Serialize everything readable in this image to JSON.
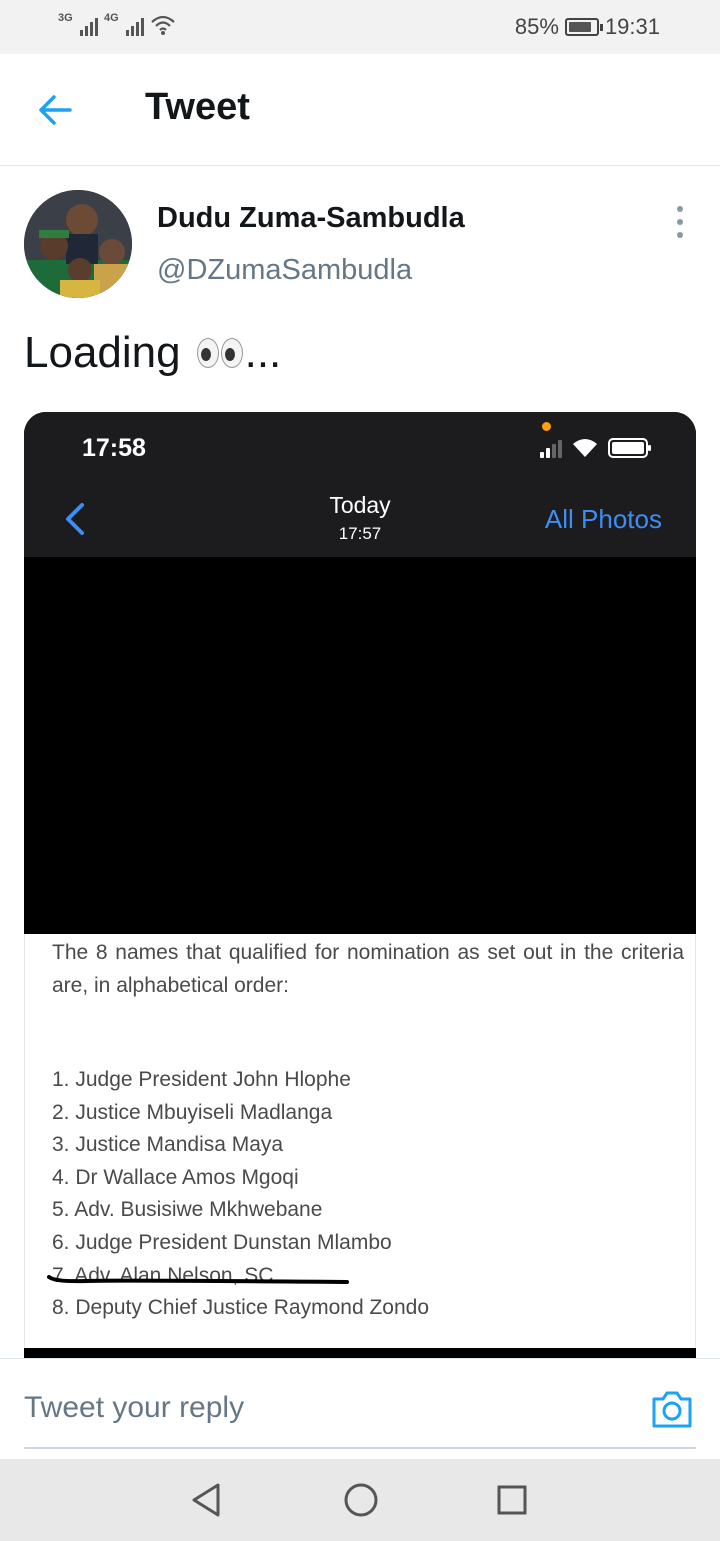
{
  "status_bar": {
    "network1": "3G",
    "network2": "4G",
    "battery_percent": "85%",
    "battery_level": 0.85,
    "time": "19:31"
  },
  "header": {
    "title": "Tweet",
    "back_icon": "back-arrow-icon"
  },
  "tweet": {
    "author_name": "Dudu Zuma-Sambudla",
    "author_handle": "@DZumaSambudla",
    "text_prefix": "Loading",
    "text_suffix": "...",
    "emoji": "eyes-emoji",
    "more_icon": "more-vertical-icon"
  },
  "media": {
    "ios_time": "17:58",
    "nav_title": "Today",
    "nav_subtitle": "17:57",
    "nav_right": "All Photos",
    "intro": "The 8 names that qualified for nomination as set out in the criteria are, in alphabetical order:",
    "list": [
      "1. Judge President John Hlophe",
      "2. Justice Mbuyiseli Madlanga",
      "3. Justice Mandisa Maya",
      "4. Dr Wallace Amos Mgoqi",
      "5. Adv. Busisiwe Mkhwebane",
      "6. Judge President Dunstan Mlambo",
      "7. Adv. Alan Nelson, SC",
      "8. Deputy Chief Justice Raymond Zondo"
    ]
  },
  "reply": {
    "placeholder": "Tweet your reply",
    "camera_icon": "camera-icon"
  },
  "colors": {
    "twitter_blue": "#1da1f2",
    "ios_blue": "#3d8df5",
    "handle_gray": "#657786"
  }
}
